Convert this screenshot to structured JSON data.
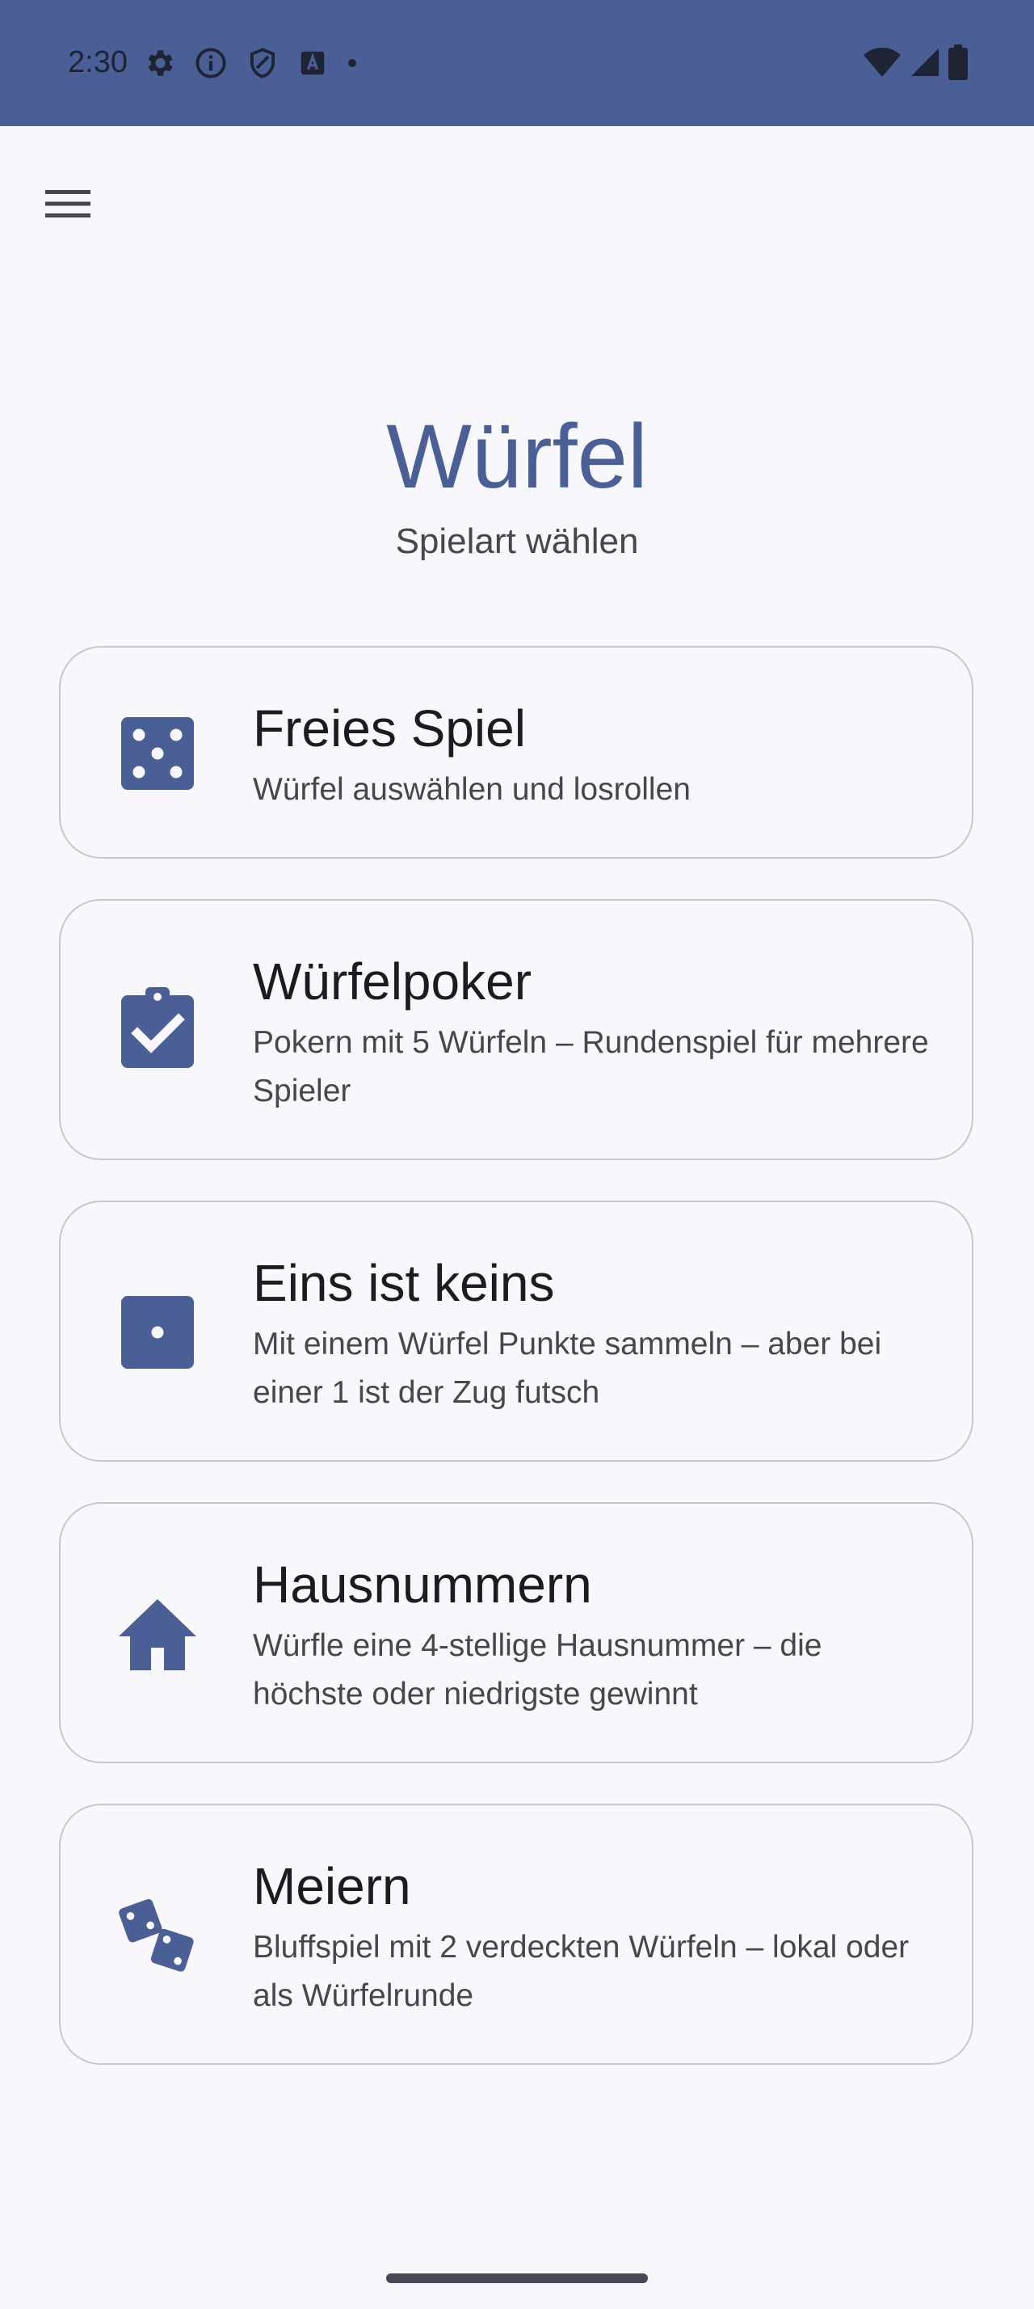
{
  "status_bar": {
    "time": "2:30",
    "left_icons": [
      "settings-icon",
      "info-icon",
      "shield-icon",
      "font-icon",
      "dot-icon"
    ],
    "right_icons": [
      "wifi-icon",
      "signal-icon",
      "battery-icon"
    ],
    "color": "#4a5f95"
  },
  "app": {
    "menu_icon": "hamburger-menu-icon",
    "title": "Würfel",
    "subtitle": "Spielart wählen",
    "accent_color": "#4a5f95"
  },
  "games": [
    {
      "icon": "dice-five-icon",
      "title": "Freies Spiel",
      "description": "Würfel auswählen und losrollen"
    },
    {
      "icon": "clipboard-check-icon",
      "title": "Würfelpoker",
      "description": "Pokern mit 5 Würfeln – Rundenspiel für mehrere Spieler"
    },
    {
      "icon": "dice-one-icon",
      "title": "Eins ist keins",
      "description": "Mit einem Würfel Punkte sammeln – aber bei einer 1 ist der Zug futsch"
    },
    {
      "icon": "house-icon",
      "title": "Hausnummern",
      "description": "Würfle eine 4-stellige Hausnummer – die höchste oder niedrigste gewinnt"
    },
    {
      "icon": "dice-pair-icon",
      "title": "Meiern",
      "description": "Bluffspiel mit 2 verdeckten Würfeln – lokal oder als Würfelrunde"
    }
  ]
}
